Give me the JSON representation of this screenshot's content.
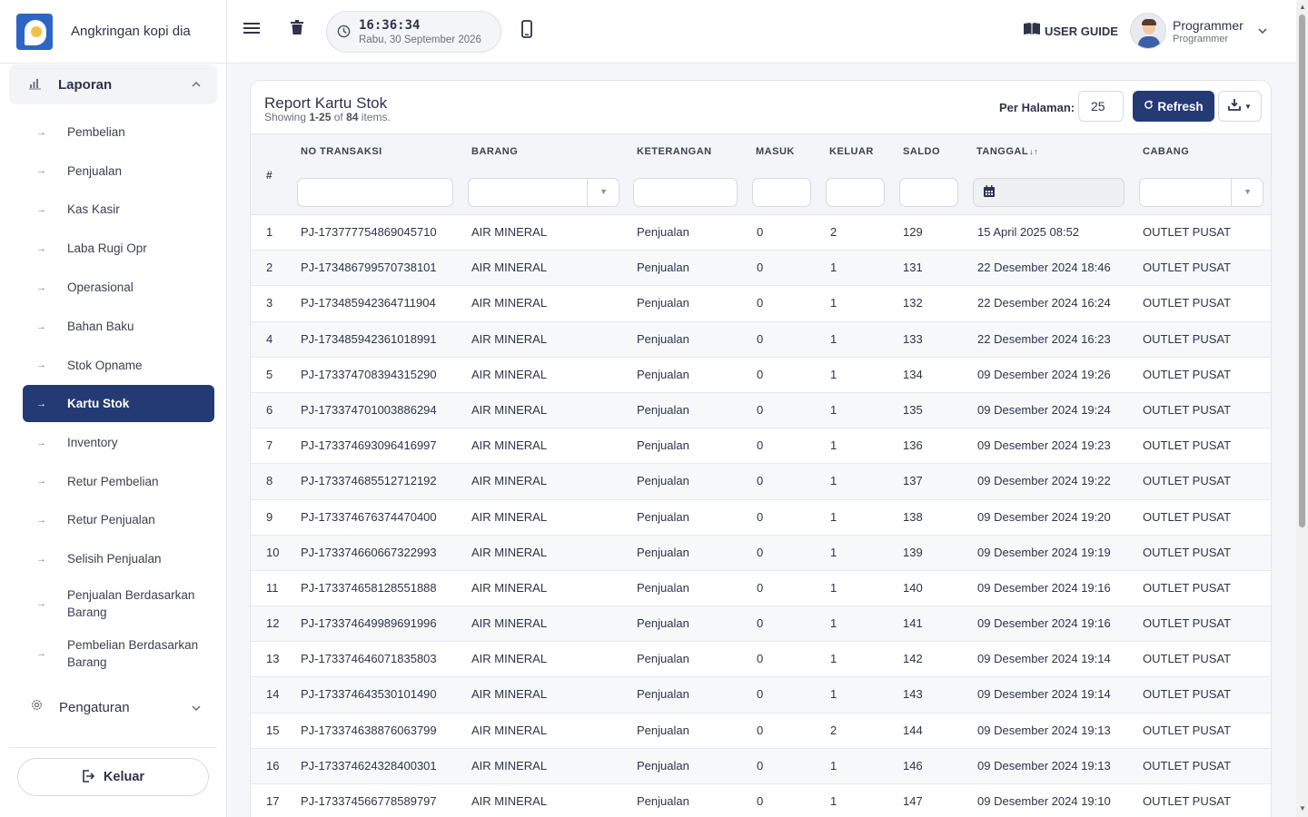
{
  "brand": {
    "name": "Angkringan kopi dia"
  },
  "sidebar": {
    "group_label": "Laporan",
    "items": [
      {
        "label": "Pembelian",
        "active": false
      },
      {
        "label": "Penjualan",
        "active": false
      },
      {
        "label": "Kas Kasir",
        "active": false
      },
      {
        "label": "Laba Rugi Opr",
        "active": false
      },
      {
        "label": "Operasional",
        "active": false
      },
      {
        "label": "Bahan Baku",
        "active": false
      },
      {
        "label": "Stok Opname",
        "active": false
      },
      {
        "label": "Kartu Stok",
        "active": true
      },
      {
        "label": "Inventory",
        "active": false
      },
      {
        "label": "Retur Pembelian",
        "active": false
      },
      {
        "label": "Retur Penjualan",
        "active": false
      },
      {
        "label": "Selisih Penjualan",
        "active": false
      },
      {
        "label": "Penjualan Berdasarkan Barang",
        "active": false
      },
      {
        "label": "Pembelian Berdasarkan Barang",
        "active": false
      }
    ],
    "settings_label": "Pengaturan",
    "logout_label": "Keluar"
  },
  "topbar": {
    "time": "16:36:34",
    "date": "Rabu, 30 September 2026",
    "guide_label": "USER GUIDE",
    "user_name": "Programmer",
    "user_role": "Programmer"
  },
  "report": {
    "title": "Report Kartu Stok",
    "showing_prefix": "Showing ",
    "showing_range": "1-25",
    "showing_mid": " of ",
    "showing_total": "84",
    "showing_suffix": " items.",
    "per_page_label": "Per Halaman:",
    "per_page_value": "25",
    "refresh_label": "Refresh"
  },
  "table": {
    "hash": "#",
    "columns": [
      "NO TRANSAKSI",
      "BARANG",
      "KETERANGAN",
      "MASUK",
      "KELUAR",
      "SALDO",
      "TANGGAL",
      "CABANG"
    ],
    "sort_glyph": "↓↑",
    "rows": [
      {
        "n": "1",
        "no": "PJ-173777754869045710",
        "barang": "AIR MINERAL",
        "ket": "Penjualan",
        "masuk": "0",
        "keluar": "2",
        "saldo": "129",
        "tanggal": "15 April 2025 08:52",
        "cabang": "OUTLET PUSAT"
      },
      {
        "n": "2",
        "no": "PJ-173486799570738101",
        "barang": "AIR MINERAL",
        "ket": "Penjualan",
        "masuk": "0",
        "keluar": "1",
        "saldo": "131",
        "tanggal": "22 Desember 2024 18:46",
        "cabang": "OUTLET PUSAT"
      },
      {
        "n": "3",
        "no": "PJ-173485942364711904",
        "barang": "AIR MINERAL",
        "ket": "Penjualan",
        "masuk": "0",
        "keluar": "1",
        "saldo": "132",
        "tanggal": "22 Desember 2024 16:24",
        "cabang": "OUTLET PUSAT"
      },
      {
        "n": "4",
        "no": "PJ-173485942361018991",
        "barang": "AIR MINERAL",
        "ket": "Penjualan",
        "masuk": "0",
        "keluar": "1",
        "saldo": "133",
        "tanggal": "22 Desember 2024 16:23",
        "cabang": "OUTLET PUSAT"
      },
      {
        "n": "5",
        "no": "PJ-173374708394315290",
        "barang": "AIR MINERAL",
        "ket": "Penjualan",
        "masuk": "0",
        "keluar": "1",
        "saldo": "134",
        "tanggal": "09 Desember 2024 19:26",
        "cabang": "OUTLET PUSAT"
      },
      {
        "n": "6",
        "no": "PJ-173374701003886294",
        "barang": "AIR MINERAL",
        "ket": "Penjualan",
        "masuk": "0",
        "keluar": "1",
        "saldo": "135",
        "tanggal": "09 Desember 2024 19:24",
        "cabang": "OUTLET PUSAT"
      },
      {
        "n": "7",
        "no": "PJ-173374693096416997",
        "barang": "AIR MINERAL",
        "ket": "Penjualan",
        "masuk": "0",
        "keluar": "1",
        "saldo": "136",
        "tanggal": "09 Desember 2024 19:23",
        "cabang": "OUTLET PUSAT"
      },
      {
        "n": "8",
        "no": "PJ-173374685512712192",
        "barang": "AIR MINERAL",
        "ket": "Penjualan",
        "masuk": "0",
        "keluar": "1",
        "saldo": "137",
        "tanggal": "09 Desember 2024 19:22",
        "cabang": "OUTLET PUSAT"
      },
      {
        "n": "9",
        "no": "PJ-173374676374470400",
        "barang": "AIR MINERAL",
        "ket": "Penjualan",
        "masuk": "0",
        "keluar": "1",
        "saldo": "138",
        "tanggal": "09 Desember 2024 19:20",
        "cabang": "OUTLET PUSAT"
      },
      {
        "n": "10",
        "no": "PJ-173374660667322993",
        "barang": "AIR MINERAL",
        "ket": "Penjualan",
        "masuk": "0",
        "keluar": "1",
        "saldo": "139",
        "tanggal": "09 Desember 2024 19:19",
        "cabang": "OUTLET PUSAT"
      },
      {
        "n": "11",
        "no": "PJ-173374658128551888",
        "barang": "AIR MINERAL",
        "ket": "Penjualan",
        "masuk": "0",
        "keluar": "1",
        "saldo": "140",
        "tanggal": "09 Desember 2024 19:16",
        "cabang": "OUTLET PUSAT"
      },
      {
        "n": "12",
        "no": "PJ-173374649989691996",
        "barang": "AIR MINERAL",
        "ket": "Penjualan",
        "masuk": "0",
        "keluar": "1",
        "saldo": "141",
        "tanggal": "09 Desember 2024 19:16",
        "cabang": "OUTLET PUSAT"
      },
      {
        "n": "13",
        "no": "PJ-173374646071835803",
        "barang": "AIR MINERAL",
        "ket": "Penjualan",
        "masuk": "0",
        "keluar": "1",
        "saldo": "142",
        "tanggal": "09 Desember 2024 19:14",
        "cabang": "OUTLET PUSAT"
      },
      {
        "n": "14",
        "no": "PJ-173374643530101490",
        "barang": "AIR MINERAL",
        "ket": "Penjualan",
        "masuk": "0",
        "keluar": "1",
        "saldo": "143",
        "tanggal": "09 Desember 2024 19:14",
        "cabang": "OUTLET PUSAT"
      },
      {
        "n": "15",
        "no": "PJ-173374638876063799",
        "barang": "AIR MINERAL",
        "ket": "Penjualan",
        "masuk": "0",
        "keluar": "2",
        "saldo": "144",
        "tanggal": "09 Desember 2024 19:13",
        "cabang": "OUTLET PUSAT"
      },
      {
        "n": "16",
        "no": "PJ-173374624328400301",
        "barang": "AIR MINERAL",
        "ket": "Penjualan",
        "masuk": "0",
        "keluar": "1",
        "saldo": "146",
        "tanggal": "09 Desember 2024 19:13",
        "cabang": "OUTLET PUSAT"
      },
      {
        "n": "17",
        "no": "PJ-173374566778589797",
        "barang": "AIR MINERAL",
        "ket": "Penjualan",
        "masuk": "0",
        "keluar": "1",
        "saldo": "147",
        "tanggal": "09 Desember 2024 19:10",
        "cabang": "OUTLET PUSAT"
      }
    ]
  },
  "colors": {
    "primary": "#243a75",
    "background": "#f6f7fb",
    "table_header": "#f4f5f8"
  },
  "icons": [
    "menu-icon",
    "trash-icon",
    "clock-icon",
    "mobile-icon",
    "book-icon",
    "chart-icon",
    "gear-icon",
    "logout-icon",
    "refresh-icon",
    "download-icon",
    "calendar-icon",
    "arrow-right-icon",
    "chevron-up-icon",
    "chevron-down-icon"
  ]
}
